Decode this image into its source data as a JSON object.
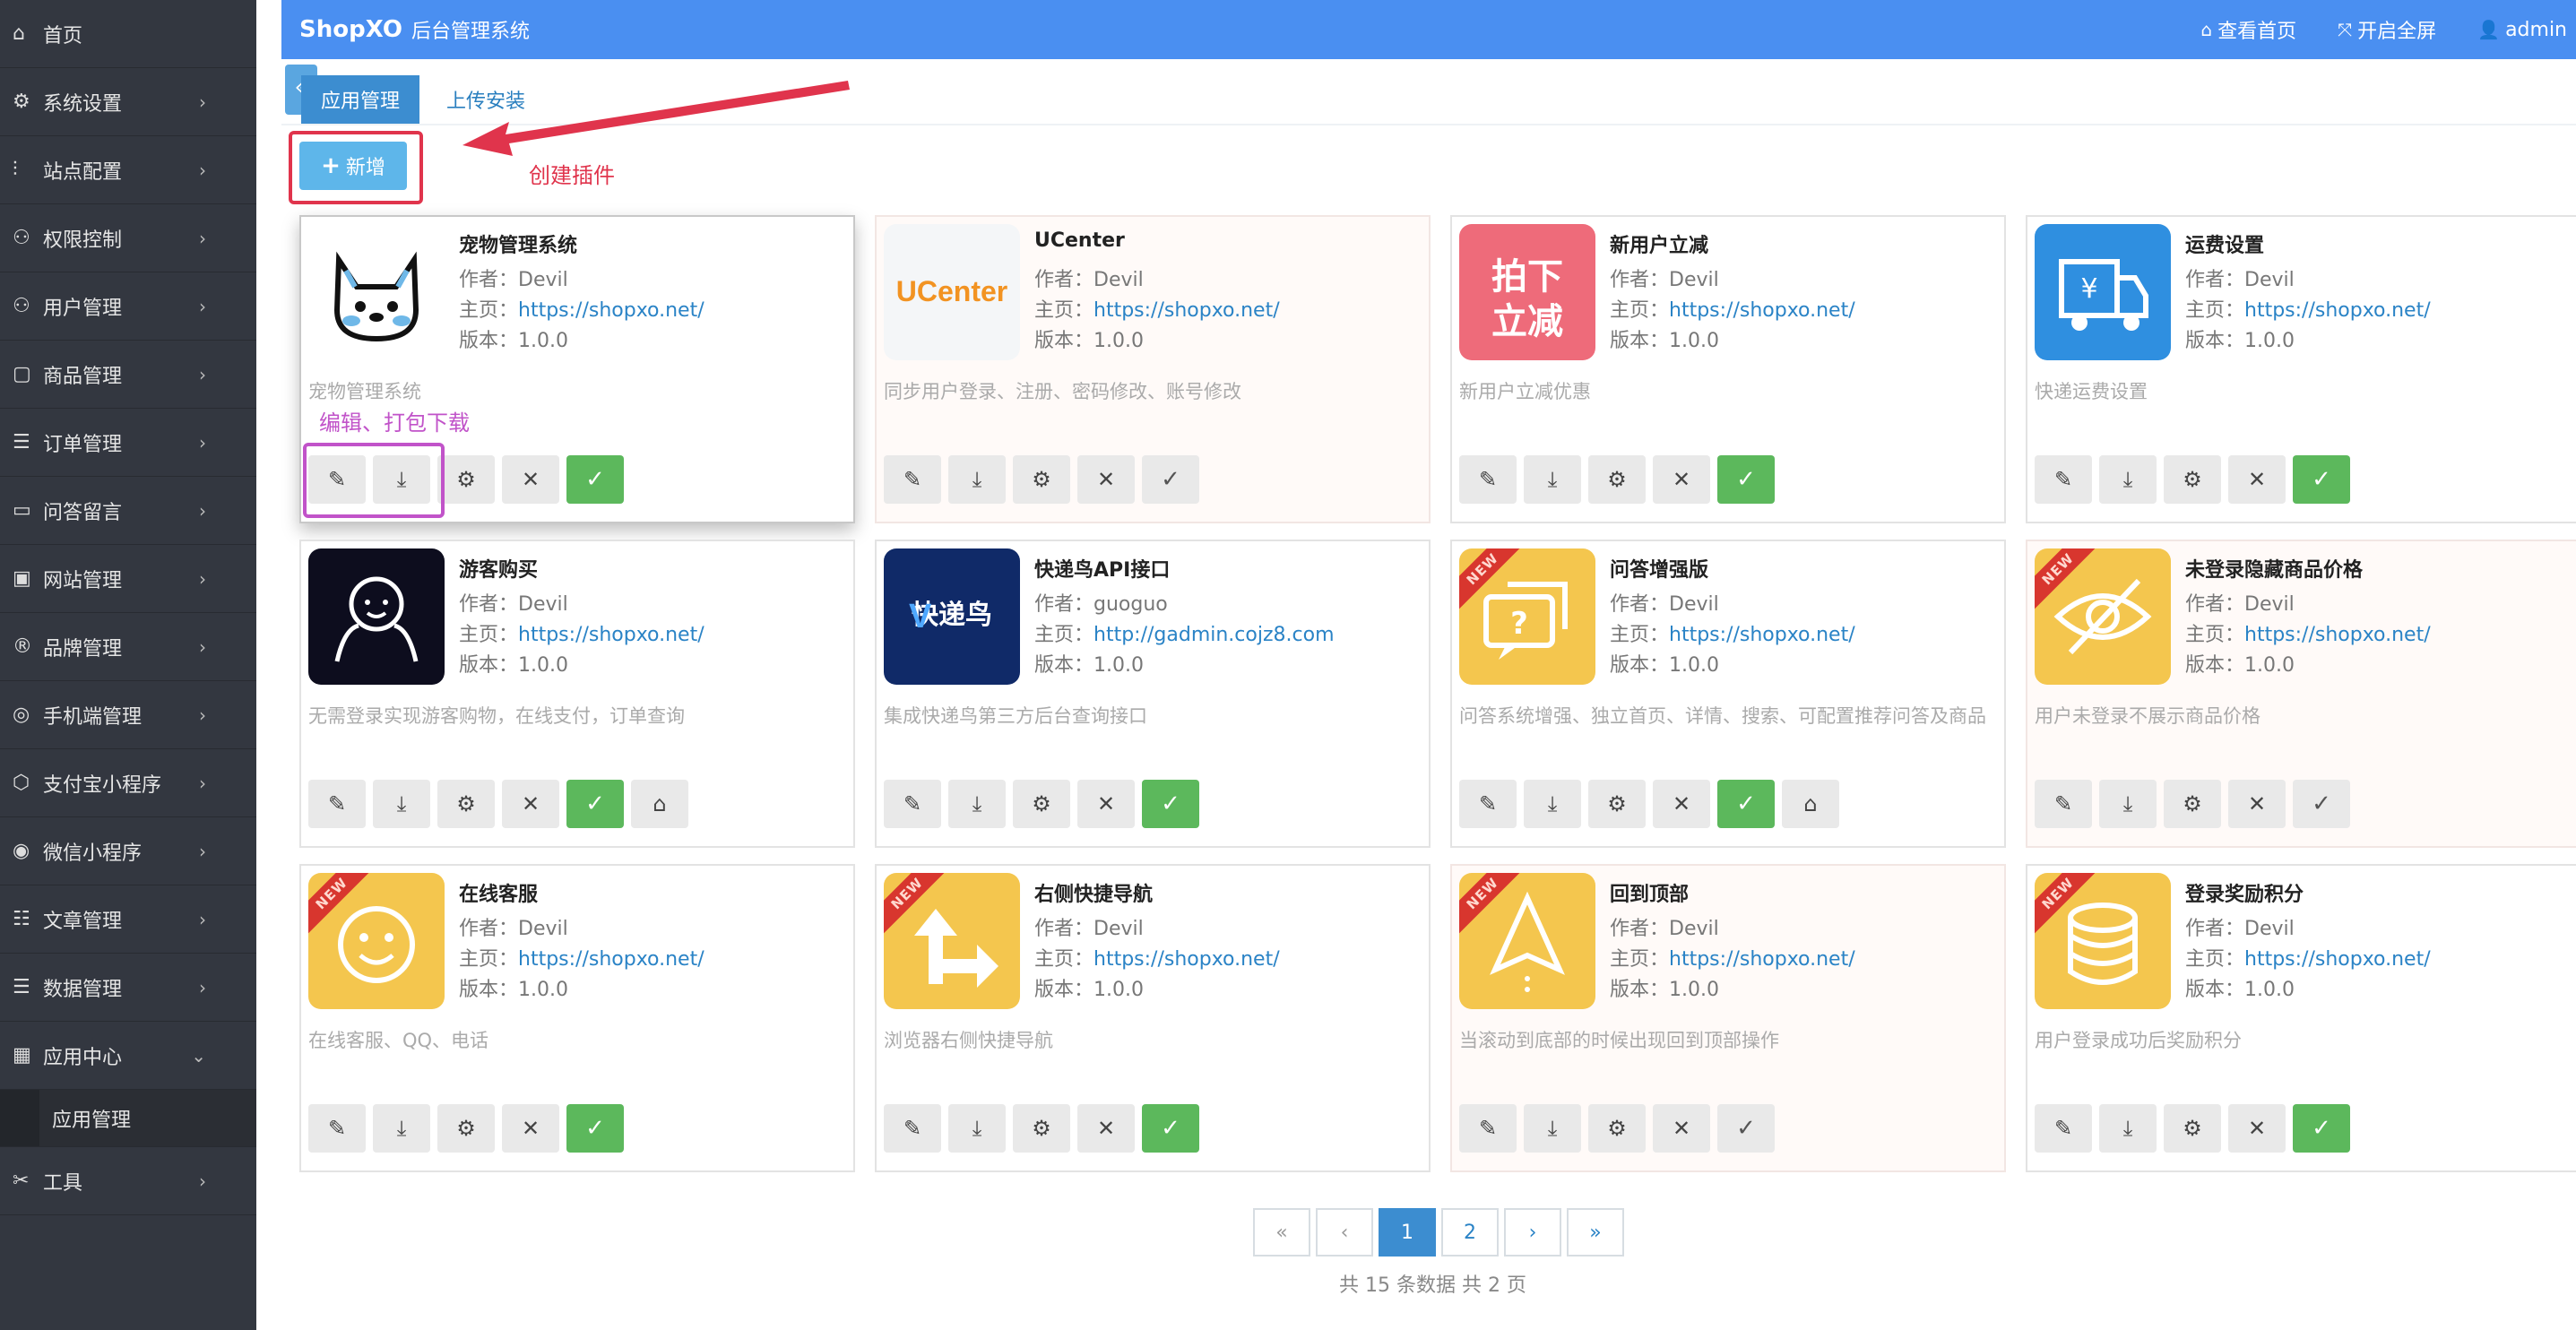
{
  "header": {
    "brand": "ShopXO",
    "subtitle": "后台管理系统",
    "links": [
      {
        "icon": "home-icon",
        "glyph": "⌂",
        "label": "查看首页"
      },
      {
        "icon": "fullscreen-icon",
        "glyph": "⤧",
        "label": "开启全屏"
      },
      {
        "icon": "user-icon",
        "glyph": "👤",
        "label": "admin"
      }
    ]
  },
  "sidebar": {
    "items": [
      {
        "icon": "home-icon",
        "glyph": "⌂",
        "label": "首页",
        "chevron": ""
      },
      {
        "icon": "gear-icon",
        "glyph": "⚙",
        "label": "系统设置",
        "chevron": "›"
      },
      {
        "icon": "sliders-icon",
        "glyph": "⫶",
        "label": "站点配置",
        "chevron": "›"
      },
      {
        "icon": "user-shield-icon",
        "glyph": "⚇",
        "label": "权限控制",
        "chevron": "›"
      },
      {
        "icon": "users-icon",
        "glyph": "⚇",
        "label": "用户管理",
        "chevron": "›"
      },
      {
        "icon": "bag-icon",
        "glyph": "▢",
        "label": "商品管理",
        "chevron": "›"
      },
      {
        "icon": "list-icon",
        "glyph": "☰",
        "label": "订单管理",
        "chevron": "›"
      },
      {
        "icon": "comment-icon",
        "glyph": "▭",
        "label": "问答留言",
        "chevron": "›"
      },
      {
        "icon": "window-icon",
        "glyph": "▣",
        "label": "网站管理",
        "chevron": "›"
      },
      {
        "icon": "brand-icon",
        "glyph": "®",
        "label": "品牌管理",
        "chevron": "›"
      },
      {
        "icon": "mobile-icon",
        "glyph": "◎",
        "label": "手机端管理",
        "chevron": "›"
      },
      {
        "icon": "alipay-icon",
        "glyph": "⬡",
        "label": "支付宝小程序",
        "chevron": "›"
      },
      {
        "icon": "wechat-icon",
        "glyph": "◉",
        "label": "微信小程序",
        "chevron": "›"
      },
      {
        "icon": "article-icon",
        "glyph": "☷",
        "label": "文章管理",
        "chevron": "›"
      },
      {
        "icon": "database-icon",
        "glyph": "☰",
        "label": "数据管理",
        "chevron": "›"
      },
      {
        "icon": "apps-icon",
        "glyph": "▦",
        "label": "应用中心",
        "chevron": "⌄"
      }
    ],
    "sub_active": "应用管理",
    "tools": {
      "icon": "tools-icon",
      "glyph": "✂",
      "label": "工具",
      "chevron": "›"
    }
  },
  "tabs": [
    {
      "label": "应用管理",
      "active": true
    },
    {
      "label": "上传安装",
      "active": false
    }
  ],
  "add_button": {
    "plus": "+",
    "label": "新增"
  },
  "annotations": {
    "create": "创建插件",
    "edit": "编辑、打包下载",
    "color_create": "#e0344c",
    "color_edit": "#c153c9"
  },
  "plugins": [
    {
      "name": "宠物管理系统",
      "author_label": "作者：",
      "author": "Devil",
      "home_label": "主页：",
      "home": "https://shopxo.net/",
      "version_label": "版本：",
      "version": "1.0.0",
      "desc": "宠物管理系统",
      "logo": "pet",
      "new": false,
      "enabled": true,
      "home_btn": false
    },
    {
      "name": "UCenter",
      "author_label": "作者：",
      "author": "Devil",
      "home_label": "主页：",
      "home": "https://shopxo.net/",
      "version_label": "版本：",
      "version": "1.0.0",
      "desc": "同步用户登录、注册、密码修改、账号修改",
      "logo": "ucenter",
      "logo_text": "UCenter",
      "new": false,
      "enabled": false,
      "home_btn": false
    },
    {
      "name": "新用户立减",
      "author_label": "作者：",
      "author": "Devil",
      "home_label": "主页：",
      "home": "https://shopxo.net/",
      "version_label": "版本：",
      "version": "1.0.0",
      "desc": "新用户立减优惠",
      "logo": "newuser",
      "logo_text": "拍下立减",
      "new": false,
      "enabled": true,
      "home_btn": false
    },
    {
      "name": "运费设置",
      "author_label": "作者：",
      "author": "Devil",
      "home_label": "主页：",
      "home": "https://shopxo.net/",
      "version_label": "版本：",
      "version": "1.0.0",
      "desc": "快递运费设置",
      "logo": "freight",
      "new": false,
      "enabled": true,
      "home_btn": false
    },
    {
      "name": "游客购买",
      "author_label": "作者：",
      "author": "Devil",
      "home_label": "主页：",
      "home": "https://shopxo.net/",
      "version_label": "版本：",
      "version": "1.0.0",
      "desc": "无需登录实现游客购物，在线支付，订单查询",
      "logo": "guest",
      "new": false,
      "enabled": true,
      "home_btn": true
    },
    {
      "name": "快递鸟API接口",
      "author_label": "作者：",
      "author": "guoguo",
      "home_label": "主页：",
      "home": "http://gadmin.cojz8.com",
      "version_label": "版本：",
      "version": "1.0.0",
      "desc": "集成快递鸟第三方后台查询接口",
      "logo": "kdniao",
      "logo_text": "快递鸟",
      "new": false,
      "enabled": true,
      "home_btn": false
    },
    {
      "name": "问答增强版",
      "author_label": "作者：",
      "author": "Devil",
      "home_label": "主页：",
      "home": "https://shopxo.net/",
      "version_label": "版本：",
      "version": "1.0.0",
      "desc": "问答系统增强、独立首页、详情、搜索、可配置推荐问答及商品",
      "logo": "qa",
      "new": true,
      "enabled": true,
      "home_btn": true
    },
    {
      "name": "未登录隐藏商品价格",
      "author_label": "作者：",
      "author": "Devil",
      "home_label": "主页：",
      "home": "https://shopxo.net/",
      "version_label": "版本：",
      "version": "1.0.0",
      "desc": "用户未登录不展示商品价格",
      "logo": "hideprice",
      "new": true,
      "enabled": false,
      "home_btn": false
    },
    {
      "name": "在线客服",
      "author_label": "作者：",
      "author": "Devil",
      "home_label": "主页：",
      "home": "https://shopxo.net/",
      "version_label": "版本：",
      "version": "1.0.0",
      "desc": "在线客服、QQ、电话",
      "logo": "service",
      "new": true,
      "enabled": true,
      "home_btn": false
    },
    {
      "name": "右侧快捷导航",
      "author_label": "作者：",
      "author": "Devil",
      "home_label": "主页：",
      "home": "https://shopxo.net/",
      "version_label": "版本：",
      "version": "1.0.0",
      "desc": "浏览器右侧快捷导航",
      "logo": "nav",
      "new": true,
      "enabled": true,
      "home_btn": false
    },
    {
      "name": "回到顶部",
      "author_label": "作者：",
      "author": "Devil",
      "home_label": "主页：",
      "home": "https://shopxo.net/",
      "version_label": "版本：",
      "version": "1.0.0",
      "desc": "当滚动到底部的时候出现回到顶部操作",
      "logo": "top",
      "new": true,
      "enabled": false,
      "home_btn": false
    },
    {
      "name": "登录奖励积分",
      "author_label": "作者：",
      "author": "Devil",
      "home_label": "主页：",
      "home": "https://shopxo.net/",
      "version_label": "版本：",
      "version": "1.0.0",
      "desc": "用户登录成功后奖励积分",
      "logo": "points",
      "new": true,
      "enabled": true,
      "home_btn": false
    }
  ],
  "new_badge": "NEW",
  "pagination": {
    "first": "«",
    "prev": "‹",
    "pages": [
      "1",
      "2"
    ],
    "current": "1",
    "next": "›",
    "last": "»",
    "info": "共 15 条数据  共 2 页"
  },
  "colors": {
    "header_bg": "#4a8ff1",
    "sidebar_bg": "#333740",
    "primary": "#3c8dd0",
    "success": "#5cb85c",
    "link": "#2a83c6"
  }
}
